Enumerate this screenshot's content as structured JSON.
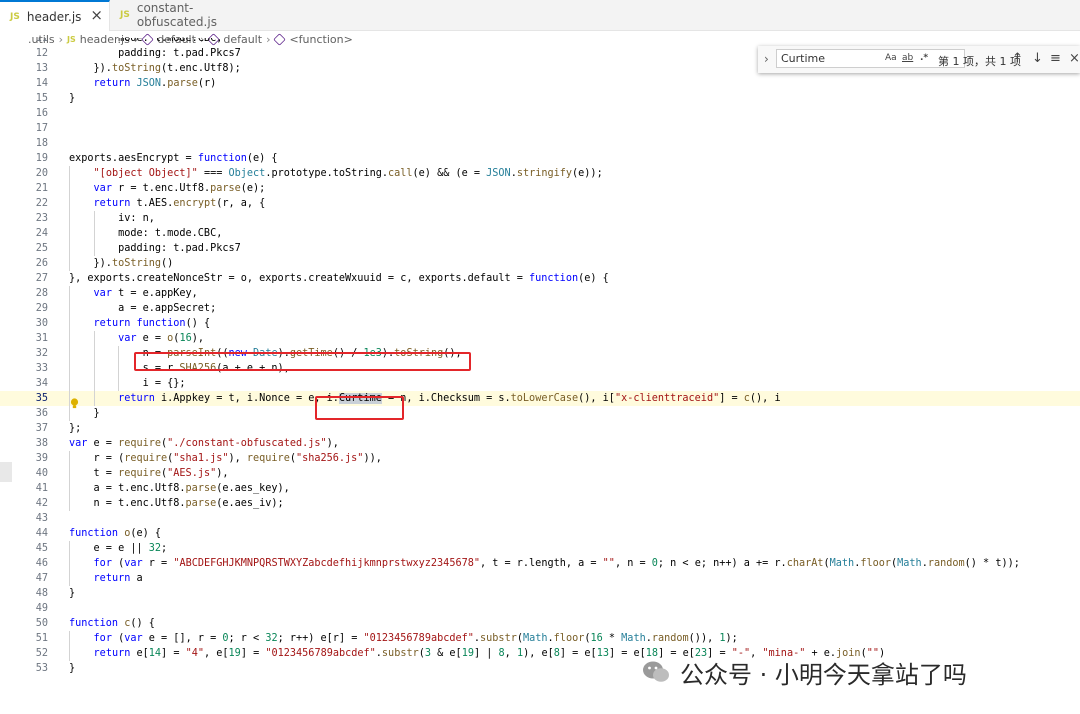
{
  "tabs": [
    {
      "icon": "JS",
      "label": "header.js",
      "active": true,
      "close": "×"
    },
    {
      "icon": "JS",
      "label": "constant-obfuscated.js",
      "active": false
    }
  ],
  "breadcrumb": [
    ".utils",
    "header.js",
    "default",
    "default",
    "<function>"
  ],
  "find_widget": {
    "query": "Curtime",
    "opt_case": "Aa",
    "opt_word": "ab",
    "opt_regex": ".*",
    "result": "第 1 项，共 1 项",
    "up": "↑",
    "down": "↓",
    "menu": "≡",
    "close": "×"
  },
  "code": {
    "current_line": 35,
    "lines": [
      {
        "n": 11,
        "text": "        mode: t.mode.CBC,"
      },
      {
        "n": 12,
        "text": "        padding: t.pad.Pkcs7"
      },
      {
        "n": 13,
        "text": "    }).toString(t.enc.Utf8);"
      },
      {
        "n": 14,
        "text": "    return JSON.parse(r)"
      },
      {
        "n": 15,
        "text": "}"
      },
      {
        "n": 16,
        "text": ""
      },
      {
        "n": 17,
        "text": ""
      },
      {
        "n": 18,
        "text": ""
      },
      {
        "n": 19,
        "text": "exports.aesEncrypt = function(e) {"
      },
      {
        "n": 20,
        "text": "    \"[object Object]\" === Object.prototype.toString.call(e) && (e = JSON.stringify(e));"
      },
      {
        "n": 21,
        "text": "    var r = t.enc.Utf8.parse(e);"
      },
      {
        "n": 22,
        "text": "    return t.AES.encrypt(r, a, {"
      },
      {
        "n": 23,
        "text": "        iv: n,"
      },
      {
        "n": 24,
        "text": "        mode: t.mode.CBC,"
      },
      {
        "n": 25,
        "text": "        padding: t.pad.Pkcs7"
      },
      {
        "n": 26,
        "text": "    }).toString()"
      },
      {
        "n": 27,
        "text": "}, exports.createNonceStr = o, exports.createWxuuid = c, exports.default = function(e) {"
      },
      {
        "n": 28,
        "text": "    var t = e.appKey,"
      },
      {
        "n": 29,
        "text": "        a = e.appSecret;"
      },
      {
        "n": 30,
        "text": "    return function() {"
      },
      {
        "n": 31,
        "text": "        var e = o(16),"
      },
      {
        "n": 32,
        "text": "            n = parseInt((new Date).getTime() / 1e3).toString(),"
      },
      {
        "n": 33,
        "text": "            s = r.SHA256(a + e + n),"
      },
      {
        "n": 34,
        "text": "            i = {};"
      },
      {
        "n": 35,
        "text": "        return i.Appkey = t, i.Nonce = e, i.Curtime = n, i.Checksum = s.toLowerCase(), i[\"x-clienttraceid\"] = c(), i"
      },
      {
        "n": 36,
        "text": "    }"
      },
      {
        "n": 37,
        "text": "};"
      },
      {
        "n": 38,
        "text": "var e = require(\"./constant-obfuscated.js\"),"
      },
      {
        "n": 39,
        "text": "    r = (require(\"sha1.js\"), require(\"sha256.js\")),"
      },
      {
        "n": 40,
        "text": "    t = require(\"AES.js\"),"
      },
      {
        "n": 41,
        "text": "    a = t.enc.Utf8.parse(e.aes_key),"
      },
      {
        "n": 42,
        "text": "    n = t.enc.Utf8.parse(e.aes_iv);"
      },
      {
        "n": 43,
        "text": ""
      },
      {
        "n": 44,
        "text": "function o(e) {"
      },
      {
        "n": 45,
        "text": "    e = e || 32;"
      },
      {
        "n": 46,
        "text": "    for (var r = \"ABCDEFGHJKMNPQRSTWXYZabcdefhijkmnprstwxyz2345678\", t = r.length, a = \"\", n = 0; n < e; n++) a += r.charAt(Math.floor(Math.random() * t));"
      },
      {
        "n": 47,
        "text": "    return a"
      },
      {
        "n": 48,
        "text": "}"
      },
      {
        "n": 49,
        "text": ""
      },
      {
        "n": 50,
        "text": "function c() {"
      },
      {
        "n": 51,
        "text": "    for (var e = [], r = 0; r < 32; r++) e[r] = \"0123456789abcdef\".substr(Math.floor(16 * Math.random()), 1);"
      },
      {
        "n": 52,
        "text": "    return e[14] = \"4\", e[19] = \"0123456789abcdef\".substr(3 & e[19] | 8, 1), e[8] = e[13] = e[18] = e[23] = \"-\", \"mina-\" + e.join(\"\")"
      },
      {
        "n": 53,
        "text": "}"
      }
    ]
  },
  "watermark": "公众号 · 小明今天拿站了吗"
}
